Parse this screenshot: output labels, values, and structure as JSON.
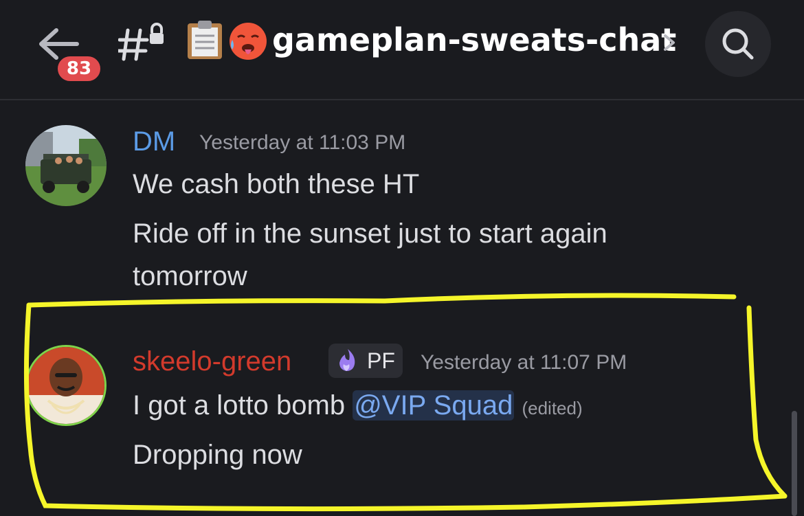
{
  "header": {
    "unread_count": "83",
    "channel_name": "gameplan-sweats-chat",
    "icons": [
      "back-arrow-icon",
      "locked-channel-icon",
      "clipboard-emoji-icon",
      "hot-face-emoji-icon",
      "chevron-right-icon",
      "search-icon"
    ]
  },
  "messages": [
    {
      "author": "DM",
      "author_color": "#5b9be6",
      "timestamp": "Yesterday at 11:03 PM",
      "lines": [
        "We cash both these HT",
        "Ride off in the sunset just to start again",
        "tomorrow"
      ]
    },
    {
      "author": "skeelo-green",
      "author_color": "#d23a2c",
      "role_tag": "PF",
      "timestamp": "Yesterday at 11:07 PM",
      "line1_text": "I got a lotto bomb ",
      "mention": "@VIP Squad",
      "edited": "(edited)",
      "line2_text": "Dropping now"
    }
  ],
  "colors": {
    "background": "#1a1b1f",
    "highlight_annotation": "#f5f52a",
    "badge": "#e14b4e",
    "mention_bg": "#243149",
    "mention_text": "#7aa9f0"
  }
}
